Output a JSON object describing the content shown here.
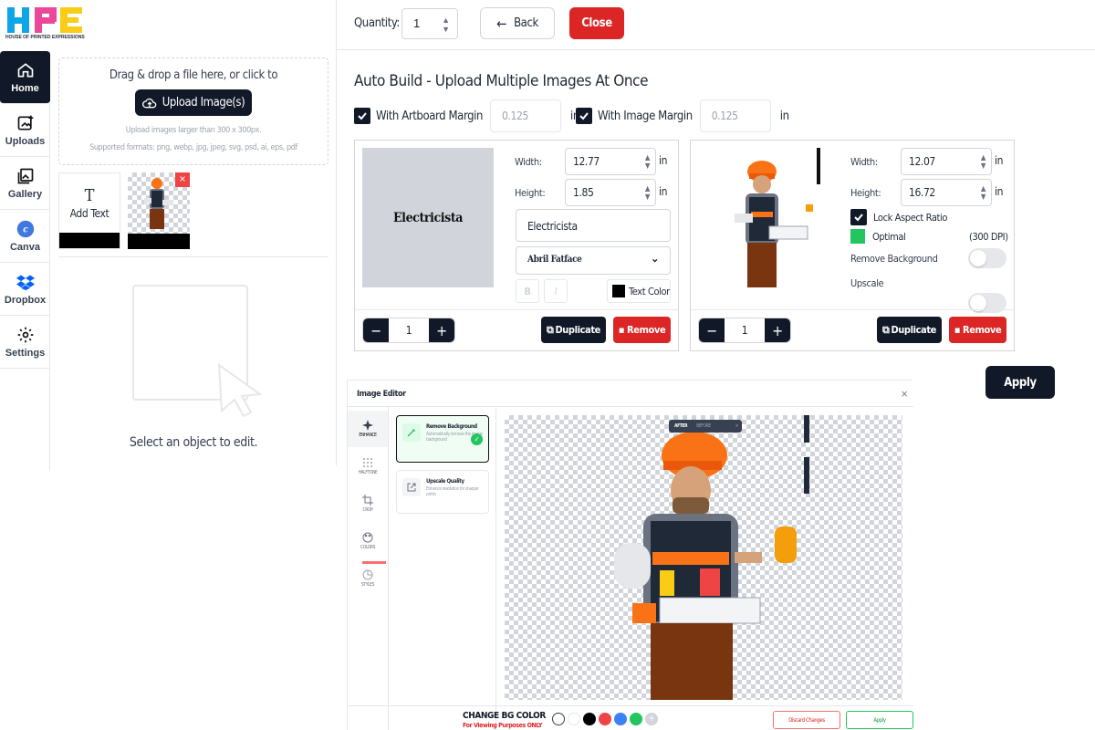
{
  "brand": {
    "logo_text": "HPE",
    "tagline": "HOUSE OF PRINTED EXPRESSIONS"
  },
  "nav": [
    {
      "label": "Home",
      "icon": "home-icon",
      "active": true
    },
    {
      "label": "Uploads",
      "icon": "upload-image-icon"
    },
    {
      "label": "Gallery",
      "icon": "gallery-icon"
    },
    {
      "label": "Canva",
      "icon": "canva-icon"
    },
    {
      "label": "Dropbox",
      "icon": "dropbox-icon"
    },
    {
      "label": "Settings",
      "icon": "gear-icon"
    }
  ],
  "upload": {
    "title": "Drag & drop a file here, or click to",
    "button": "Upload Image(s)",
    "hint1": "Upload images larger than 300 x 300px.",
    "hint2": "Supported formats: png, webp, jpg, jpeg, svg, psd, ai, eps, pdf"
  },
  "thumbs": {
    "add_text": "Add Text"
  },
  "select_hint": "Select an object to edit.",
  "topbar": {
    "quantity_label": "Quantity:",
    "quantity_value": "1",
    "back": "Back",
    "close": "Close"
  },
  "auto_build": {
    "title": "Auto Build - Upload Multiple Images At Once",
    "artboard_margin_label": "With Artboard Margin",
    "artboard_margin_placeholder": "0.125",
    "image_margin_label": "With Image Margin",
    "image_margin_placeholder": "0.125",
    "unit": "in"
  },
  "card1": {
    "preview_text": "Electricista",
    "width_label": "Width:",
    "width": "12.77",
    "height_label": "Height:",
    "height": "1.85",
    "unit": "in",
    "text_value": "Electricista",
    "font": "Abril Fatface",
    "bold": "B",
    "italic": "I",
    "text_color_label": "Text Color",
    "text_color": "#000000",
    "qty": "1",
    "duplicate": "Duplicate",
    "remove": "Remove"
  },
  "card2": {
    "width_label": "Width:",
    "width": "12.07",
    "height_label": "Height:",
    "height": "16.72",
    "unit": "in",
    "lock_label": "Lock Aspect Ratio",
    "quality_label": "Optimal",
    "dpi": "(300 DPI)",
    "remove_bg_label": "Remove Background",
    "upscale_label": "Upscale",
    "qty": "1",
    "duplicate": "Duplicate",
    "remove": "Remove"
  },
  "apply": "Apply",
  "editor": {
    "title": "Image Editor",
    "close": "×",
    "tools": [
      "ENHANCE",
      "HALFTONE",
      "CROP",
      "COLORS",
      "STYLES"
    ],
    "options": [
      {
        "title": "Remove Background",
        "desc": "Automatically remove the image background"
      },
      {
        "title": "Upscale Quality",
        "desc": "Enhance resolution for sharper prints"
      }
    ],
    "after": "AFTER",
    "before": "BEFORE",
    "bg_title": "CHANGE BG COLOR",
    "bg_sub": "For Viewing Purposes ONLY",
    "swatches": [
      "#ffffff",
      "#ffffff",
      "#000000",
      "#ef4444",
      "#3b82f6",
      "#22c55e",
      "#d1d5db"
    ],
    "discard": "Discard Changes",
    "apply": "Apply"
  },
  "colors": {
    "accent": "#111827",
    "danger": "#dc2626",
    "success": "#22c55e"
  }
}
